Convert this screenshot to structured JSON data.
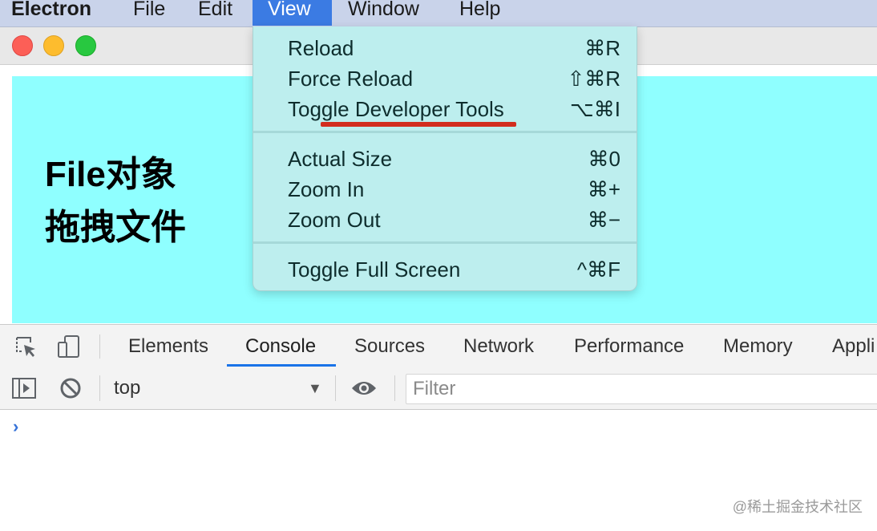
{
  "menubar": {
    "app": "Electron",
    "items": [
      "File",
      "Edit",
      "View",
      "Window",
      "Help"
    ]
  },
  "page": {
    "line1": "File对象",
    "line2": "拖拽文件"
  },
  "view_menu": {
    "groups": [
      [
        {
          "label": "Reload",
          "shortcut": "⌘R"
        },
        {
          "label": "Force Reload",
          "shortcut": "⇧⌘R"
        },
        {
          "label": "Toggle Developer Tools",
          "shortcut": "⌥⌘I"
        }
      ],
      [
        {
          "label": "Actual Size",
          "shortcut": "⌘0"
        },
        {
          "label": "Zoom In",
          "shortcut": "⌘+"
        },
        {
          "label": "Zoom Out",
          "shortcut": "⌘−"
        }
      ],
      [
        {
          "label": "Toggle Full Screen",
          "shortcut": "^⌘F"
        }
      ]
    ]
  },
  "devtools": {
    "tabs": [
      "Elements",
      "Console",
      "Sources",
      "Network",
      "Performance",
      "Memory",
      "Appli"
    ],
    "selected_tab": "Console",
    "context": "top",
    "filter_placeholder": "Filter",
    "prompt": "›"
  },
  "watermark": "@稀土掘金技术社区",
  "colors": {
    "menubar": "#c9d3ea",
    "menu_highlight": "#3b7be3",
    "page_bg": "#8fffff",
    "menu_bg": "#bdeeee",
    "annotation_red": "#d22d1f",
    "tab_accent": "#1a73e8"
  }
}
